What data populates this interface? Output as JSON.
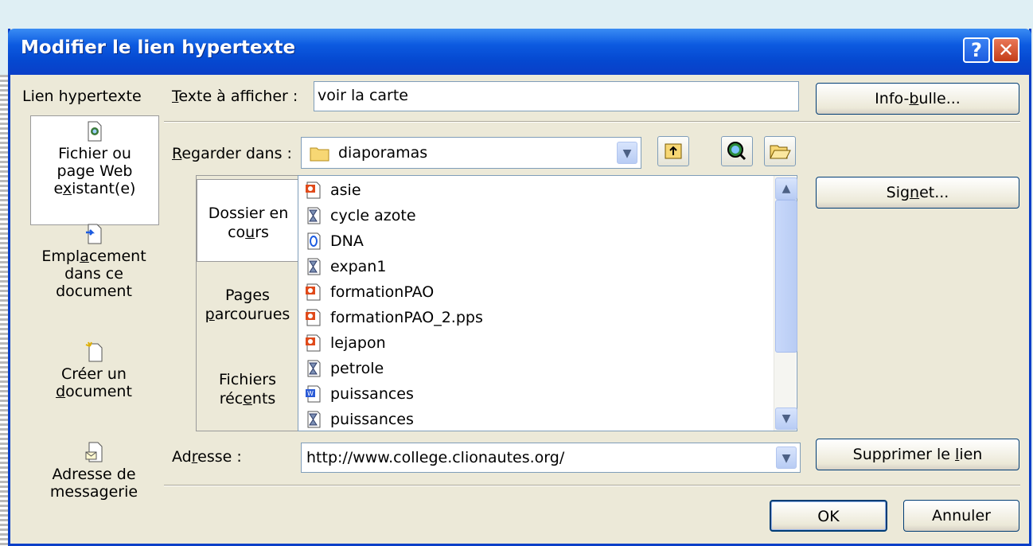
{
  "window": {
    "title": "Modifier le lien hypertexte"
  },
  "titlebar": {
    "help_glyph": "?",
    "close_glyph": "✕"
  },
  "sidebar": {
    "heading": "Lien hypertexte",
    "items": [
      {
        "lines": [
          "Fichier ou",
          "page Web",
          "existant(e)"
        ],
        "icon": "web-file-icon"
      },
      {
        "lines": [
          "Emplacement",
          "dans ce",
          "document"
        ],
        "icon": "place-in-document-icon"
      },
      {
        "lines": [
          "Créer un",
          "document"
        ],
        "icon": "new-document-icon"
      },
      {
        "lines": [
          "Adresse de",
          "messagerie"
        ],
        "icon": "email-address-icon"
      }
    ]
  },
  "text_to_display": {
    "label": "Texte à afficher :",
    "value": "voir la carte"
  },
  "look_in": {
    "label": "Regarder dans :",
    "value": "diaporamas"
  },
  "nav": [
    {
      "lines": [
        "Dossier en",
        "cours"
      ]
    },
    {
      "lines": [
        "Pages",
        "parcourues"
      ]
    },
    {
      "lines": [
        "Fichiers",
        "récents"
      ]
    }
  ],
  "files": [
    {
      "name": "asie",
      "icon": "pps-icon"
    },
    {
      "name": "cycle azote",
      "icon": "hourglass-icon"
    },
    {
      "name": "DNA",
      "icon": "shortcut-icon"
    },
    {
      "name": "expan1",
      "icon": "hourglass-icon"
    },
    {
      "name": "formationPAO",
      "icon": "pps-icon"
    },
    {
      "name": "formationPAO_2.pps",
      "icon": "pps-icon"
    },
    {
      "name": "lejapon",
      "icon": "pps-icon"
    },
    {
      "name": "petrole",
      "icon": "hourglass-icon"
    },
    {
      "name": "puissances",
      "icon": "word-doc-icon"
    },
    {
      "name": "puissances",
      "icon": "hourglass-icon"
    }
  ],
  "address": {
    "label": "Adresse :",
    "value": "http://www.college.clionautes.org/"
  },
  "buttons": {
    "tooltip": "Info-bulle...",
    "bookmark": "Signet...",
    "remove_link": "Supprimer le lien",
    "ok": "OK",
    "cancel": "Annuler"
  },
  "colors": {
    "title_blue": "#0a3fc8",
    "dialog_bg": "#ece9d8",
    "close_red": "#c43d17"
  }
}
